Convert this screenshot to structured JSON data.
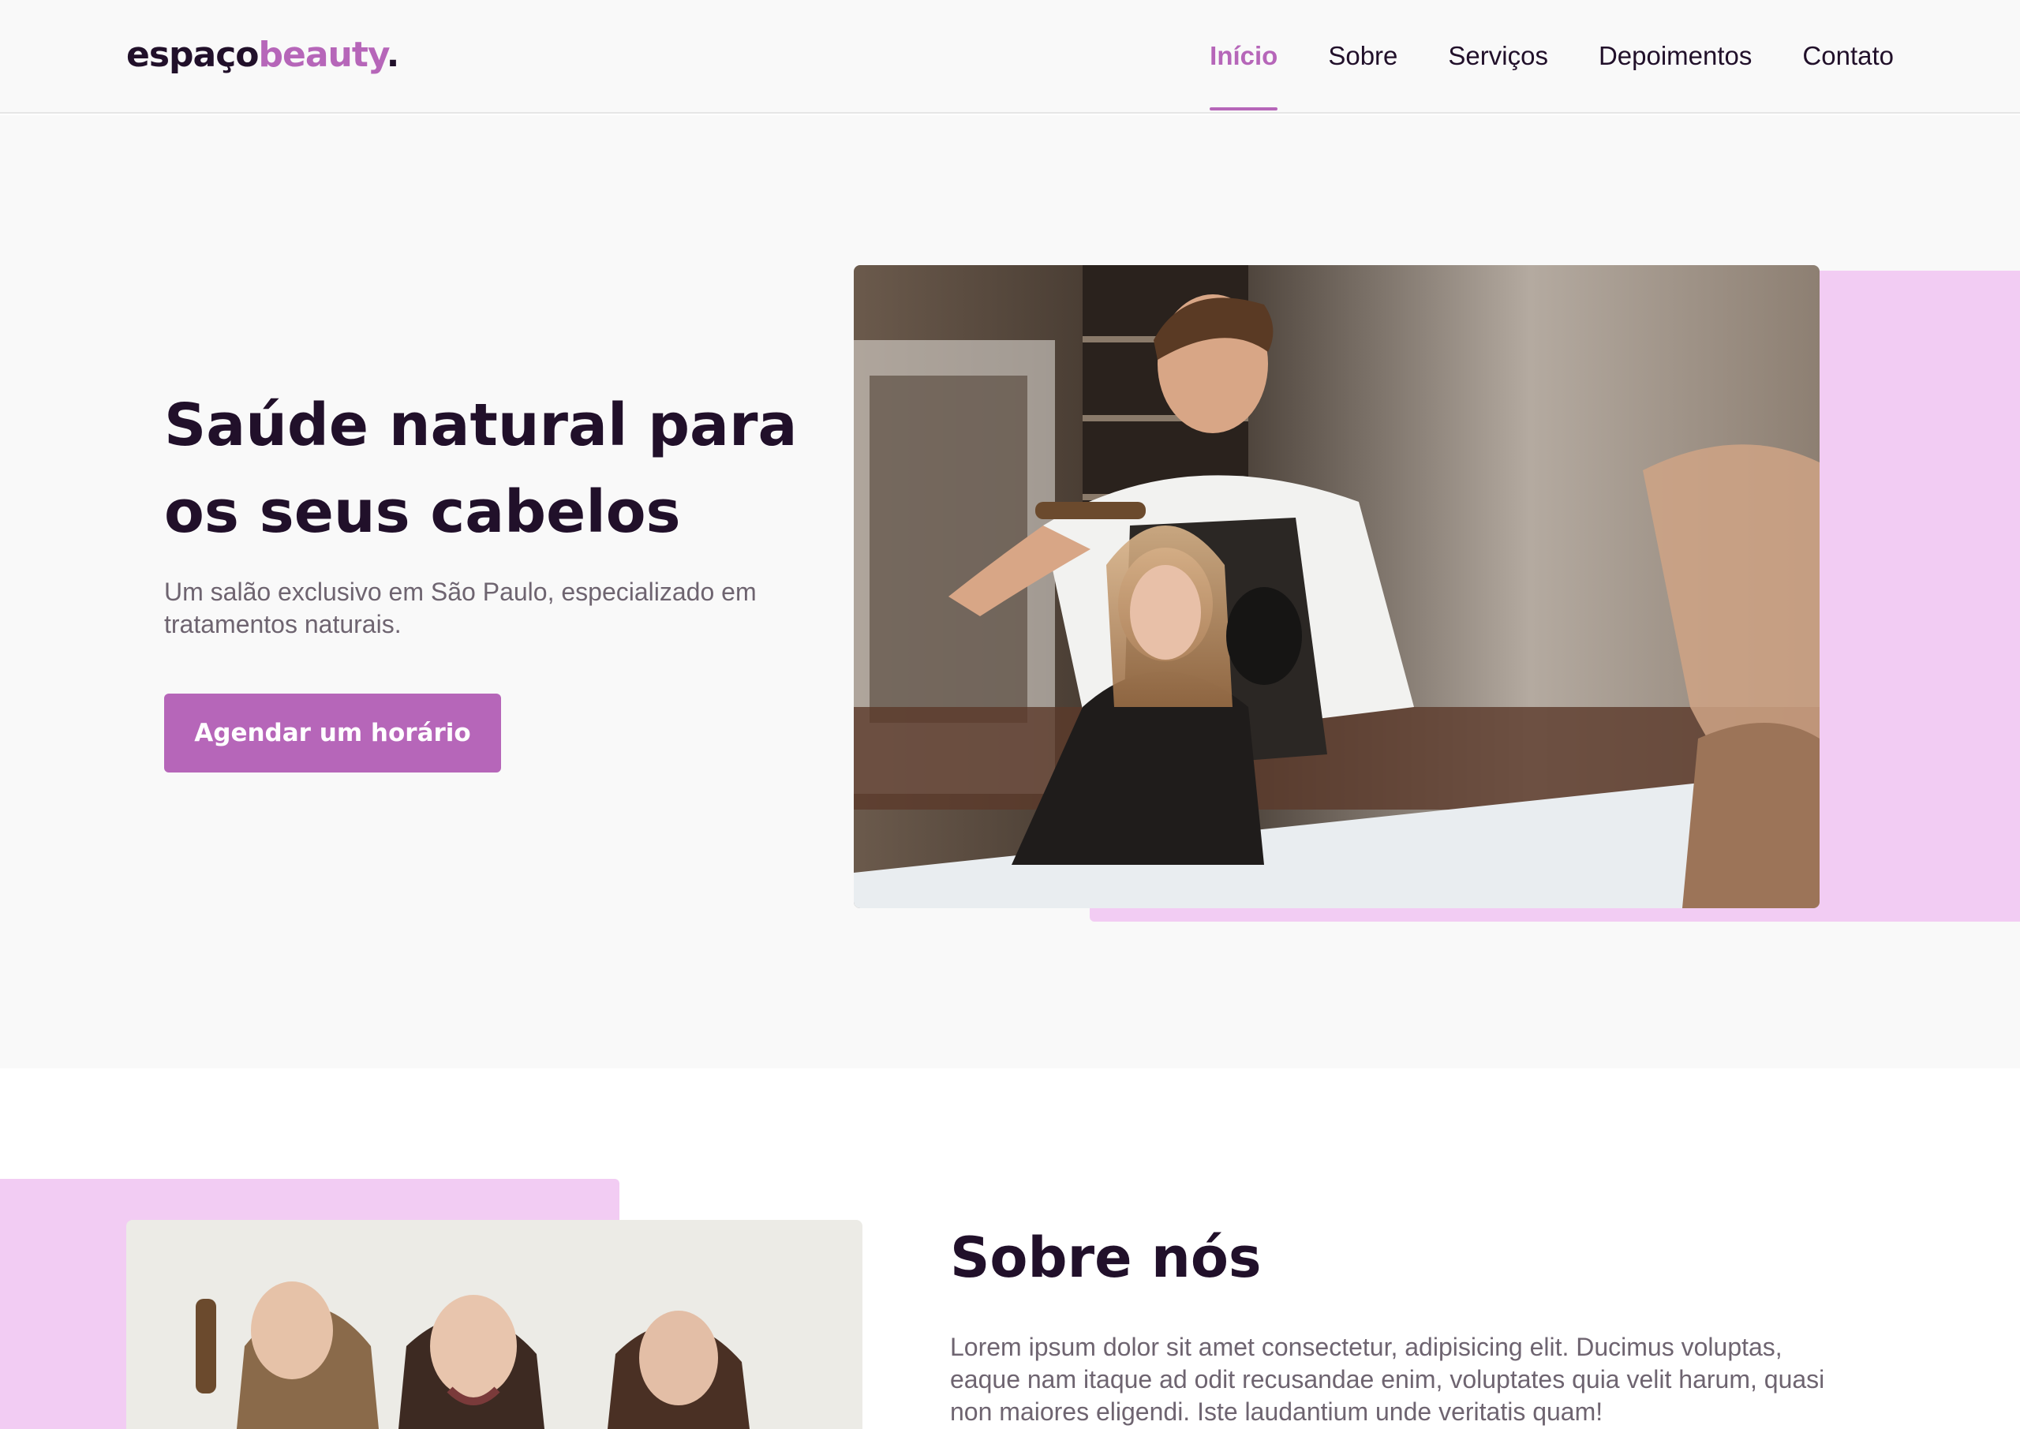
{
  "header": {
    "logo": {
      "part1": "espaço",
      "part2": "beauty",
      "part3": "."
    },
    "nav": [
      {
        "label": "Início",
        "active": true
      },
      {
        "label": "Sobre",
        "active": false
      },
      {
        "label": "Serviços",
        "active": false
      },
      {
        "label": "Depoimentos",
        "active": false
      },
      {
        "label": "Contato",
        "active": false
      }
    ]
  },
  "hero": {
    "title": "Saúde natural para os seus cabelos",
    "subtitle": "Um salão exclusivo em São Paulo, especializado em tratamentos naturais.",
    "cta_label": "Agendar um horário",
    "image_subject": "hairdresser-styling-client-photo"
  },
  "about": {
    "title": "Sobre nós",
    "text": "Lorem ipsum dolor sit amet consectetur, adipisicing elit. Ducimus voluptas, eaque nam itaque ad odit recusandae enim, voluptates quia velit harum, quasi non maiores eligendi. Iste laudantium unde veritatis quam!",
    "image_subject": "three-stylists-team-photo"
  },
  "colors": {
    "accent": "#b666b9",
    "accent_light": "#f2ccf3",
    "text_dark": "#21102a",
    "text_muted": "#6e6470",
    "bg_light": "#f9f9f9"
  }
}
